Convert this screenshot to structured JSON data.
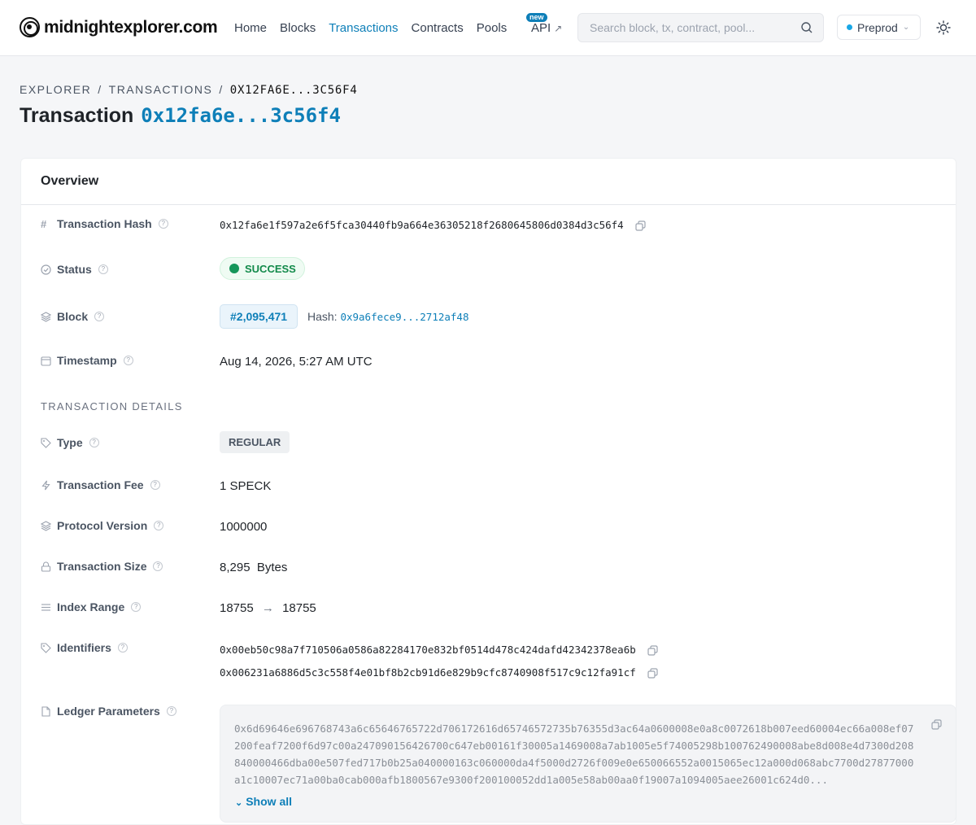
{
  "header": {
    "logo_text": "midnightexplorer.com",
    "nav": [
      {
        "label": "Home",
        "active": false
      },
      {
        "label": "Blocks",
        "active": false
      },
      {
        "label": "Transactions",
        "active": true
      },
      {
        "label": "Contracts",
        "active": false
      },
      {
        "label": "Pools",
        "active": false
      }
    ],
    "api_label": "API",
    "api_badge": "new",
    "search_placeholder": "Search block, tx, contract, pool...",
    "network": "Preprod"
  },
  "breadcrumb": {
    "root": "Explorer",
    "section": "Transactions",
    "current": "0x12fa6e...3c56f4"
  },
  "title": {
    "prefix": "Transaction",
    "hash": "0x12fa6e...3c56f4"
  },
  "card": {
    "title": "Overview"
  },
  "rows": {
    "tx_hash": {
      "label": "Transaction Hash",
      "value": "0x12fa6e1f597a2e6f5fca30440fb9a664e36305218f2680645806d0384d3c56f4"
    },
    "status": {
      "label": "Status",
      "value": "SUCCESS"
    },
    "block": {
      "label": "Block",
      "number": "#2,095,471",
      "hash_label": "Hash:",
      "hash": "0x9a6fece9...2712af48"
    },
    "timestamp": {
      "label": "Timestamp",
      "value": "Aug 14, 2026, 5:27 AM UTC"
    }
  },
  "details": {
    "section_title": "Transaction Details",
    "type": {
      "label": "Type",
      "value": "REGULAR"
    },
    "fee": {
      "label": "Transaction Fee",
      "value": "1 SPECK"
    },
    "protocol": {
      "label": "Protocol Version",
      "value": "1000000"
    },
    "size": {
      "label": "Transaction Size",
      "value": "8,295  Bytes"
    },
    "index_range": {
      "label": "Index Range",
      "from": "18755",
      "to": "18755"
    },
    "identifiers": {
      "label": "Identifiers",
      "values": [
        "0x00eb50c98a7f710506a0586a82284170e832bf0514d478c424dafd42342378ea6b",
        "0x006231a6886d5c3c558f4e01bf8b2cb91d6e829b9cfc8740908f517c9c12fa91cf"
      ]
    },
    "ledger": {
      "label": "Ledger Parameters",
      "value": "0x6d69646e696768743a6c65646765722d706172616d65746572735b76355d3ac64a0600008e0a8c0072618b007eed60004ec66a008ef07200feaf7200f6d97c00a247090156426700c647eb00161f30005a1469008a7ab1005e5f74005298b100762490008abe8d008e4d7300d208840000466dba00e507fed717b0b25a040000163c060000da4f5000d2726f009e0e650066552a0015065ec12a000d068abc7700d27877000a1c10007ec71a00ba0cab000afb1800567e9300f200100052dd1a005e58ab00aa0f19007a1094005aee26001c624d0...",
      "show_all": "Show all"
    }
  }
}
